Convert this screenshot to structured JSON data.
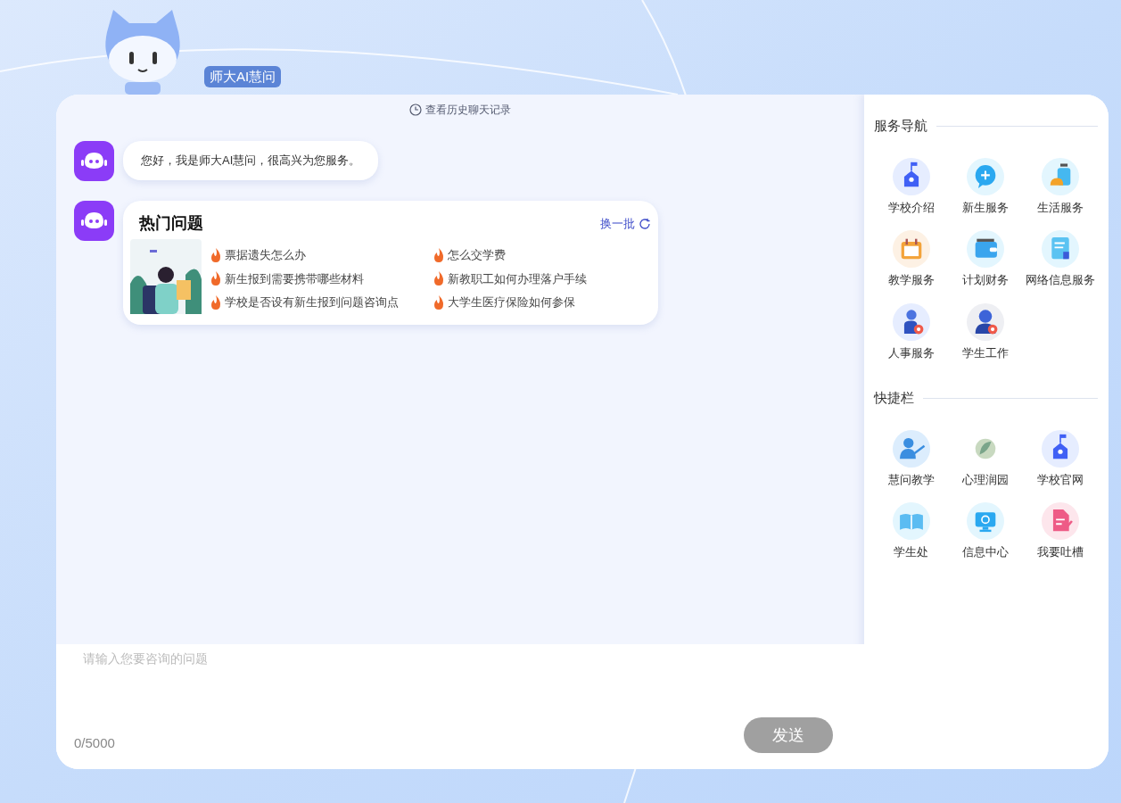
{
  "header": {
    "title": "师大AI慧问"
  },
  "chat": {
    "history_link": "查看历史聊天记录",
    "greeting": "您好，我是师大AI慧问，很高兴为您服务。",
    "hot_questions": {
      "title": "热门问题",
      "refresh": "换一批",
      "questions": [
        "票据遗失怎么办",
        "怎么交学费",
        "新生报到需要携带哪些材料",
        "新教职工如何办理落户手续",
        "学校是否设有新生报到问题咨询点",
        "大学生医疗保险如何参保"
      ]
    }
  },
  "input": {
    "placeholder": "请输入您要咨询的问题",
    "counter": "0/5000",
    "send": {
      "label": "发送",
      "disabled": true
    }
  },
  "sidebar": {
    "sections": [
      {
        "title": "服务导航",
        "items": [
          {
            "label": "学校介绍",
            "kind": "school"
          },
          {
            "label": "新生服务",
            "kind": "bubble"
          },
          {
            "label": "生活服务",
            "kind": "suitcase"
          },
          {
            "label": "教学服务",
            "kind": "calendar"
          },
          {
            "label": "计划财务",
            "kind": "wallet"
          },
          {
            "label": "网络信息服务",
            "kind": "document"
          },
          {
            "label": "人事服务",
            "kind": "person"
          },
          {
            "label": "学生工作",
            "kind": "person2"
          }
        ]
      },
      {
        "title": "快捷栏",
        "items": [
          {
            "label": "慧问教学",
            "kind": "teacher"
          },
          {
            "label": "心理润园",
            "kind": "leaf"
          },
          {
            "label": "学校官网",
            "kind": "school"
          },
          {
            "label": "学生处",
            "kind": "book"
          },
          {
            "label": "信息中心",
            "kind": "monitor"
          },
          {
            "label": "我要吐槽",
            "kind": "note"
          }
        ]
      }
    ]
  }
}
